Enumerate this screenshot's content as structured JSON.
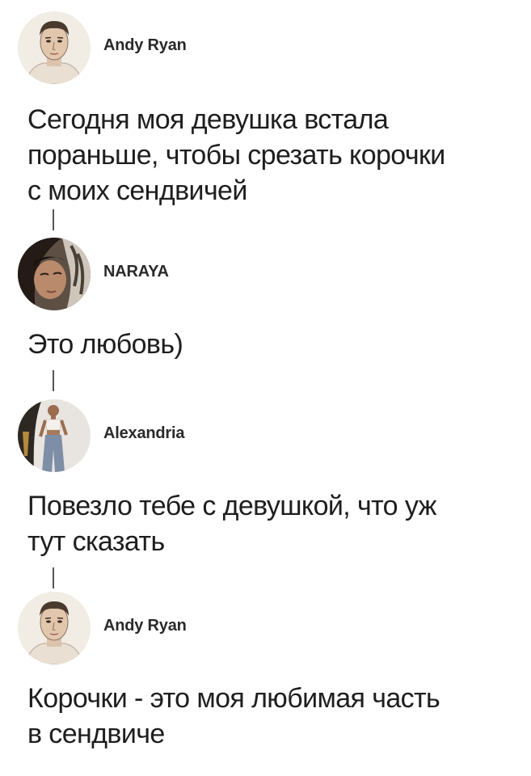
{
  "thread": {
    "posts": [
      {
        "author": "Andy Ryan",
        "avatar_icon": "man-portrait-avatar",
        "text_lines": [
          "Сегодня моя девушка встала",
          "пораньше, чтобы срезать корочки",
          "с моих сендвичей"
        ]
      },
      {
        "author": "NARAYA",
        "avatar_icon": "woman-selfie-avatar",
        "text_lines": [
          "Это любовь)"
        ]
      },
      {
        "author": "Alexandria",
        "avatar_icon": "woman-standing-avatar",
        "text_lines": [
          "Повезло тебе с девушкой, что уж",
          "тут сказать"
        ]
      },
      {
        "author": "Andy Ryan",
        "avatar_icon": "man-portrait-avatar",
        "text_lines": [
          "Корочки - это моя любимая часть",
          "в сендвиче"
        ]
      }
    ]
  },
  "colors": {
    "background": "#ffffff",
    "text": "#1e1e1e",
    "author": "#2a2a2a",
    "connector": "#555555"
  }
}
